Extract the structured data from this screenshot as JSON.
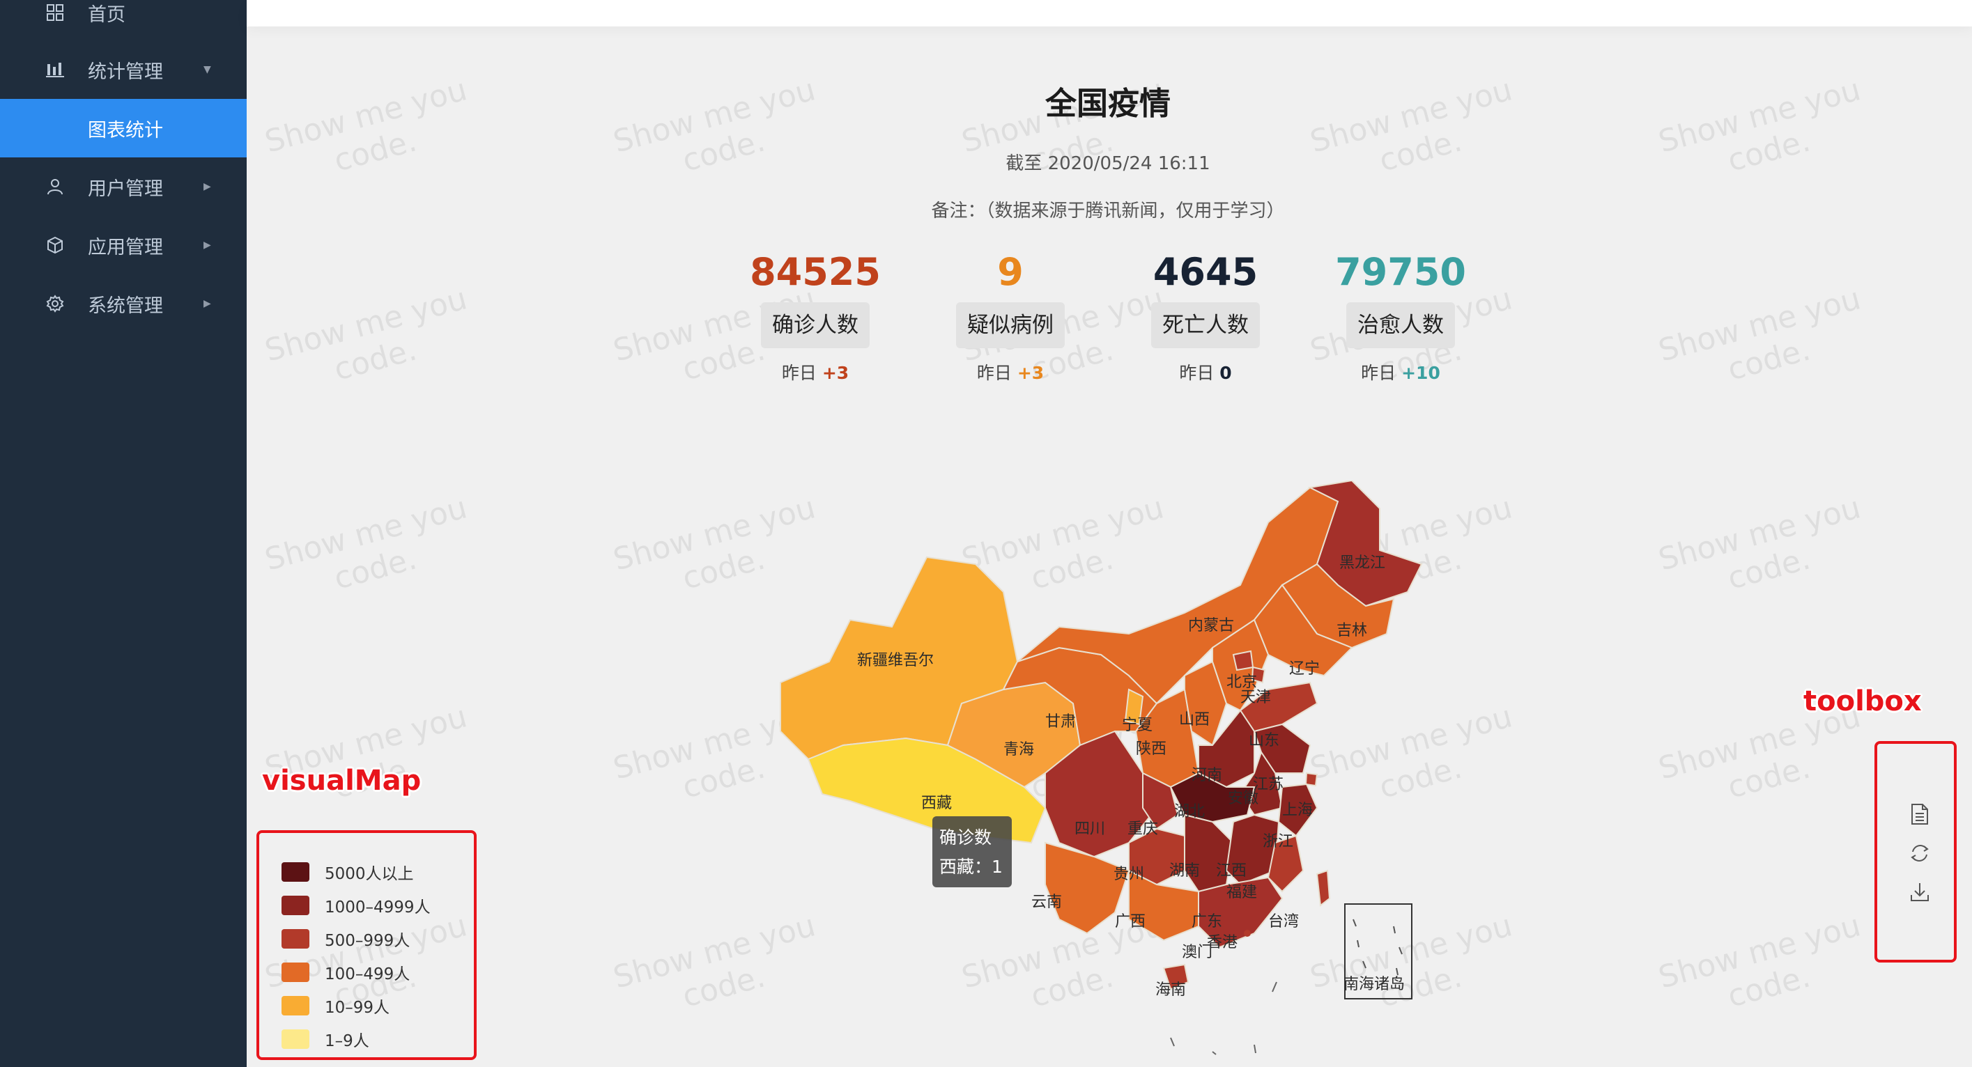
{
  "sidebar": {
    "items": [
      {
        "label": "首页",
        "icon": "grid-icon"
      },
      {
        "label": "统计管理",
        "icon": "bar-chart-icon"
      },
      {
        "label": "图表统计",
        "icon": ""
      },
      {
        "label": "用户管理",
        "icon": "user-icon"
      },
      {
        "label": "应用管理",
        "icon": "cube-icon"
      },
      {
        "label": "系统管理",
        "icon": "gear-icon"
      }
    ]
  },
  "watermark": {
    "line1": "Show me you",
    "line2": "code."
  },
  "page": {
    "title": "全国疫情",
    "as_of": "截至 2020/05/24 16:11",
    "note": "备注：（数据来源于腾讯新闻，仅用于学习）"
  },
  "stats": [
    {
      "value": "84525",
      "label": "确诊人数",
      "yesterday_label": "昨日",
      "delta": "+3",
      "color": "#c0421c"
    },
    {
      "value": "9",
      "label": "疑似病例",
      "yesterday_label": "昨日",
      "delta": "+3",
      "color": "#e8871e"
    },
    {
      "value": "4645",
      "label": "死亡人数",
      "yesterday_label": "昨日",
      "delta": "0",
      "color": "#172233"
    },
    {
      "value": "79750",
      "label": "治愈人数",
      "yesterday_label": "昨日",
      "delta": "+10",
      "color": "#3aa0a0"
    }
  ],
  "map": {
    "provinces": [
      "新疆维吾尔",
      "西藏",
      "青海",
      "甘肃",
      "宁夏",
      "内蒙古",
      "黑龙江",
      "吉林",
      "辽宁",
      "北京",
      "天津",
      "山西",
      "陕西",
      "山东",
      "河南",
      "江苏",
      "安徽",
      "上海",
      "四川",
      "重庆",
      "湖北",
      "浙江",
      "贵州",
      "湖南",
      "江西",
      "云南",
      "广西",
      "广东",
      "福建",
      "台湾",
      "香港",
      "澳门",
      "海南",
      "南海诸岛"
    ],
    "tooltip": {
      "title": "确诊数",
      "content": "西藏：1"
    }
  },
  "visual_map": {
    "annotation": "visualMap",
    "pieces": [
      {
        "label": "5000人以上",
        "color": "#5c1214"
      },
      {
        "label": "1000–4999人",
        "color": "#8c2420"
      },
      {
        "label": "500–999人",
        "color": "#b23a2a"
      },
      {
        "label": "100–499人",
        "color": "#e26a26"
      },
      {
        "label": "10–99人",
        "color": "#f9ac33"
      },
      {
        "label": "1–9人",
        "color": "#fde98a"
      }
    ]
  },
  "toolbox": {
    "annotation": "toolbox",
    "icons": [
      "data-view-icon",
      "restore-icon",
      "download-icon"
    ]
  }
}
